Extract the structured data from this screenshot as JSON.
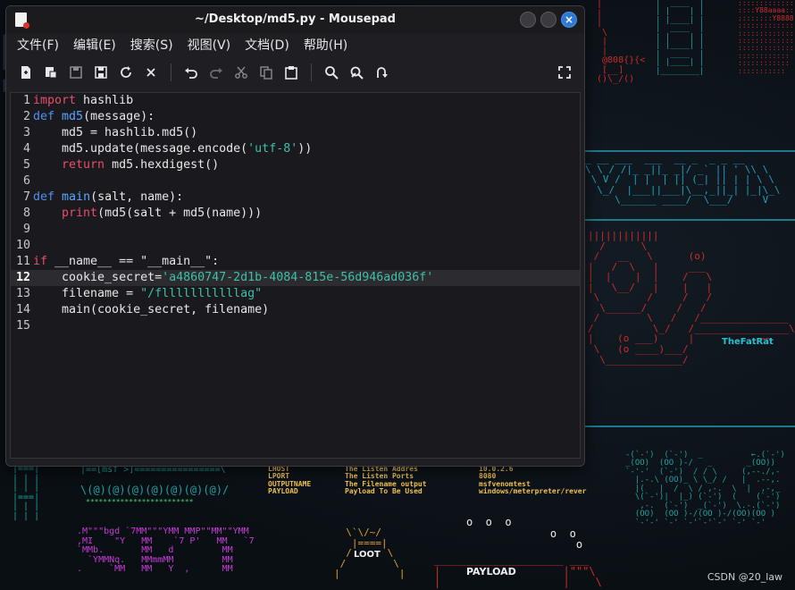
{
  "window": {
    "title": "~/Desktop/md5.py - Mousepad",
    "close_glyph": "×"
  },
  "menu": [
    "文件(F)",
    "编辑(E)",
    "搜索(S)",
    "视图(V)",
    "文档(D)",
    "帮助(H)"
  ],
  "toolbar": {
    "icons": [
      "new-document-icon",
      "new-window-icon",
      "save-icon",
      "save-as-icon",
      "reload-icon",
      "close-document-icon",
      "undo-icon",
      "redo-icon",
      "cut-icon",
      "copy-icon",
      "paste-icon",
      "find-icon",
      "find-replace-icon",
      "goto-icon",
      "fullscreen-icon"
    ]
  },
  "editor": {
    "current_line": 12,
    "lines": [
      {
        "n": "1",
        "t": [
          [
            "kw",
            "import"
          ],
          [
            "code",
            " hashlib"
          ]
        ]
      },
      {
        "n": "2",
        "t": [
          [
            "kw2",
            "def"
          ],
          [
            "code",
            " "
          ],
          [
            "fn",
            "md5"
          ],
          [
            "code",
            "(message):"
          ]
        ]
      },
      {
        "n": "3",
        "t": [
          [
            "code",
            "    md5 = hashlib.md5()"
          ]
        ]
      },
      {
        "n": "4",
        "t": [
          [
            "code",
            "    md5.update(message.encode("
          ],
          [
            "str",
            "'utf-8'"
          ],
          [
            "code",
            "))"
          ]
        ]
      },
      {
        "n": "5",
        "t": [
          [
            "code",
            "    "
          ],
          [
            "kw",
            "return"
          ],
          [
            "code",
            " md5.hexdigest()"
          ]
        ]
      },
      {
        "n": "6",
        "t": []
      },
      {
        "n": "7",
        "t": [
          [
            "kw2",
            "def"
          ],
          [
            "code",
            " "
          ],
          [
            "fn",
            "main"
          ],
          [
            "code",
            "(salt, name):"
          ]
        ]
      },
      {
        "n": "8",
        "t": [
          [
            "code",
            "    "
          ],
          [
            "kw",
            "print"
          ],
          [
            "code",
            "(md5(salt + md5(name)))"
          ]
        ]
      },
      {
        "n": "9",
        "t": []
      },
      {
        "n": "10",
        "t": []
      },
      {
        "n": "11",
        "t": [
          [
            "kw",
            "if"
          ],
          [
            "code",
            " __name__ == \"__main__\":"
          ]
        ]
      },
      {
        "n": "12",
        "t": [
          [
            "code",
            "    cookie_secret="
          ],
          [
            "str",
            "'a4860747-2d1b-4084-815e-56d946ad036f'"
          ]
        ]
      },
      {
        "n": "13",
        "t": [
          [
            "code",
            "    filename = "
          ],
          [
            "str",
            "\"/flllllllllllag\""
          ]
        ]
      },
      {
        "n": "14",
        "t": [
          [
            "code",
            "    main(cookie_secret, filename)"
          ]
        ]
      },
      {
        "n": "15",
        "t": []
      }
    ]
  },
  "wallpaper": {
    "watermark": "CSDN @20_law",
    "texts": [
      "TheFatRat",
      "LOOT",
      "PAYLOAD",
      "LHOST\nLPORT\nOUTPUTNAME\nPAYLOAD",
      "The Listen Addres\nThe Listen Ports\nThe Filename output\nPayload To Be Used",
      "10.0.2.6\n8080\nmsfvenomtest\nwindows/meterpreter/rever",
      "|==[msf >]================\\",
      "\\(@)(@)(@)(@)(@)(@)(@)/",
      ".M\"\"\"bgd `7MM\"\"\"YMM MMP\"\"MM\"\"YMM\n,MI    \"Y   MM    `7 P'   MM   `7\n`MMb.       MM   d         MM\n  `YMMNq.   MMmmMM         MM\n.     `MM   MM   Y  ,      MM"
    ]
  }
}
